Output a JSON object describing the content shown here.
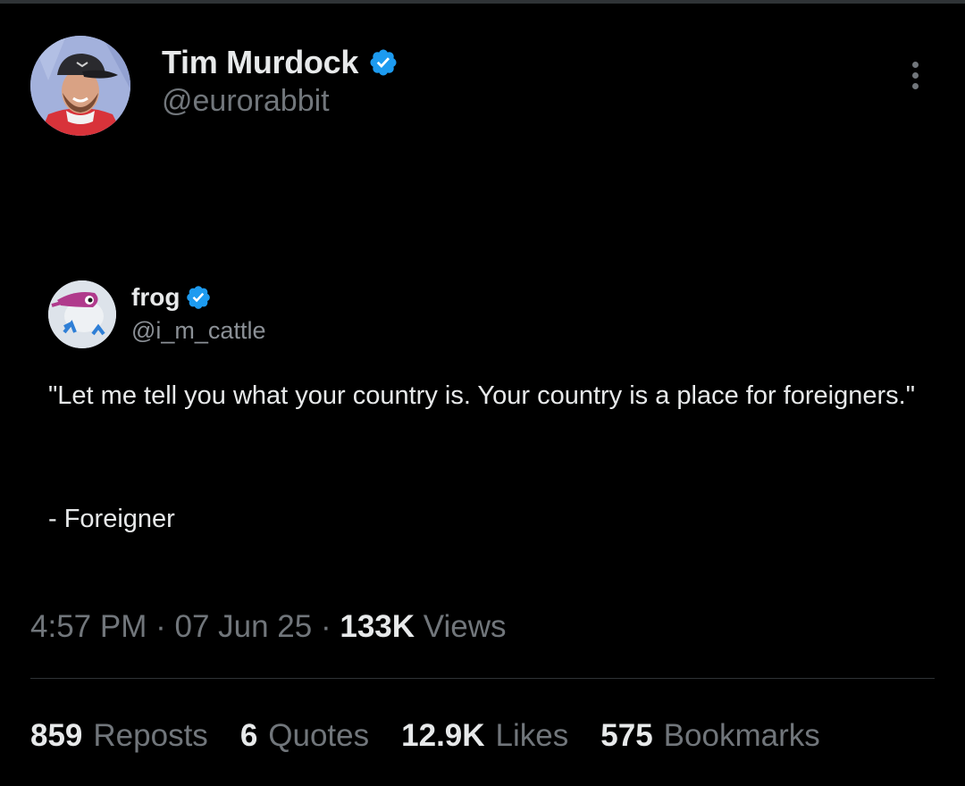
{
  "author": {
    "name": "Tim Murdock",
    "handle": "@eurorabbit",
    "verified": true
  },
  "embedded_post": {
    "name": "frog",
    "handle": "@i_m_cattle",
    "verified": true,
    "text": "\"Let me tell you what your country is. Your country is a place for foreigners.\"",
    "attribution": "- Foreigner"
  },
  "meta": {
    "time": "4:57 PM",
    "separator": "·",
    "date": "07 Jun 25",
    "views_count": "133K",
    "views_label": "Views"
  },
  "stats": [
    {
      "count": "859",
      "label": "Reposts"
    },
    {
      "count": "6",
      "label": "Quotes"
    },
    {
      "count": "12.9K",
      "label": "Likes"
    },
    {
      "count": "575",
      "label": "Bookmarks"
    }
  ],
  "colors": {
    "background": "#000000",
    "primary_text": "#e7e9ea",
    "secondary_text": "#71767b",
    "verified_badge": "#1d9bf0",
    "divider": "#2f3336"
  },
  "icons": {
    "verified": "verified-badge-icon",
    "more": "more-options-icon"
  }
}
